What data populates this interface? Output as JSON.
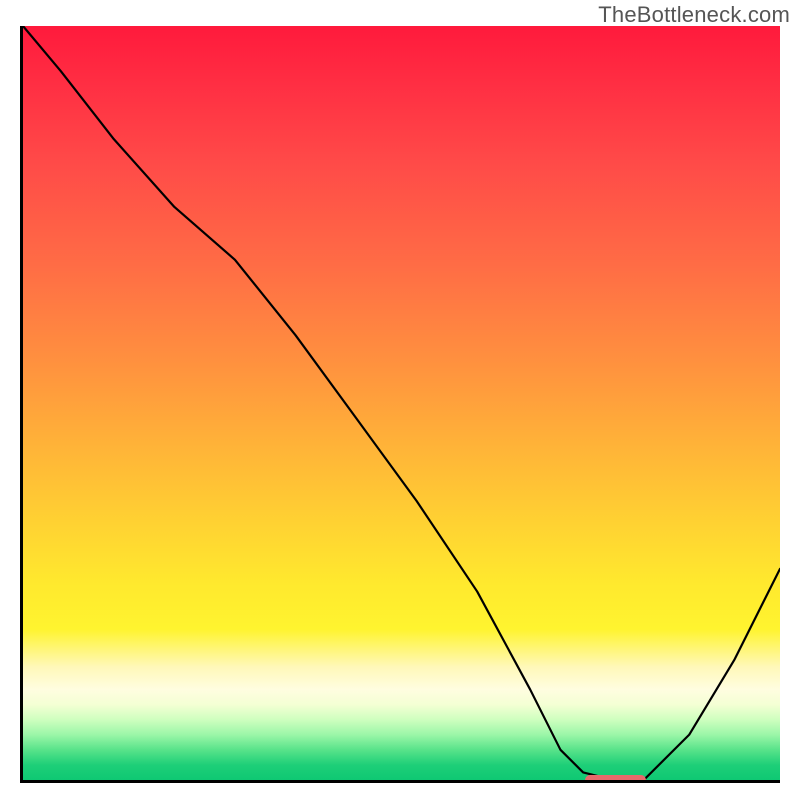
{
  "watermark": "TheBottleneck.com",
  "colors": {
    "axis": "#000000",
    "curve": "#000000",
    "marker": "#e66a6b"
  },
  "chart_data": {
    "type": "line",
    "title": "",
    "xlabel": "",
    "ylabel": "",
    "xlim": [
      0,
      100
    ],
    "ylim": [
      0,
      100
    ],
    "grid": false,
    "legend": false,
    "series": [
      {
        "name": "bottleneck-curve",
        "x": [
          0,
          5,
          12,
          20,
          28,
          36,
          44,
          52,
          60,
          67,
          71,
          74,
          78,
          82,
          88,
          94,
          100
        ],
        "y": [
          100,
          94,
          85,
          76,
          69,
          59,
          48,
          37,
          25,
          12,
          4,
          1,
          0,
          0,
          6,
          16,
          28
        ]
      }
    ],
    "marker": {
      "name": "optimal-zone",
      "x_start": 74,
      "x_end": 82,
      "y": 0
    }
  }
}
